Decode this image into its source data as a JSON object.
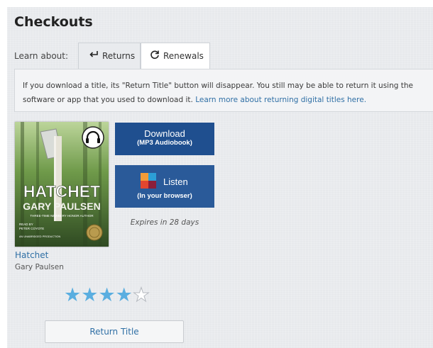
{
  "page_title": "Checkouts",
  "learn": {
    "label": "Learn about:",
    "tabs": [
      {
        "label": "Returns",
        "icon": "return-arrow-icon"
      },
      {
        "label": "Renewals",
        "icon": "refresh-icon"
      }
    ]
  },
  "info": {
    "text": "If you download a title, its \"Return Title\" button will disappear. You still may be able to return it using the software or app that you used to download it. ",
    "link": "Learn more about returning digital titles here."
  },
  "book": {
    "title": "Hatchet",
    "author": "Gary Paulsen",
    "cover": {
      "title": "HATCHET",
      "author": "GARY PAULSEN",
      "tagline": "THREE-TIME NEWBERY HONOR AUTHOR",
      "reader_label": "READ BY",
      "reader": "PETER COYOTE",
      "edition": "AN UNABRIDGED PRODUCTION",
      "badge_icon": "headphones-icon"
    },
    "rating": 4,
    "rating_max": 5
  },
  "actions": {
    "download_main": "Download",
    "download_sub": "(MP3 Audiobook)",
    "listen_main": "Listen",
    "listen_sub": "(In your browser)",
    "expires": "Expires in 28 days",
    "return_label": "Return Title"
  },
  "colors": {
    "accent_blue": "#1f4f8f",
    "link_blue": "#2f6fa5",
    "star_blue": "#5aaee0"
  }
}
